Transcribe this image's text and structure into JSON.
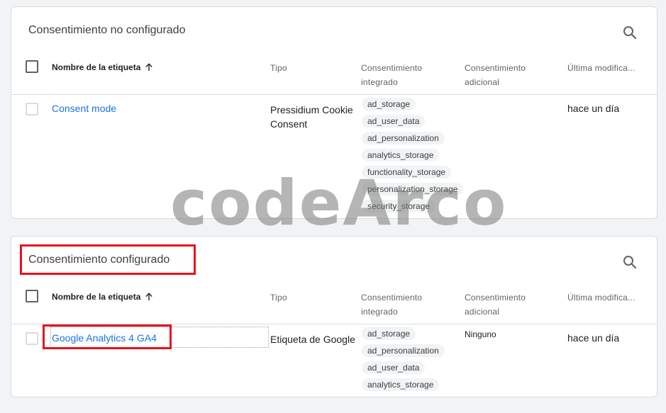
{
  "sections": [
    {
      "title": "Consentimiento no configurado",
      "columns": {
        "name": "Nombre de la etiqueta",
        "type": "Tipo",
        "integrated": "Consentimiento integrado",
        "additional": "Consentimiento adicional",
        "last_modified": "Última modifica..."
      },
      "rows": [
        {
          "name": "Consent mode",
          "type": "Pressidium Cookie Consent",
          "integrated": [
            "ad_storage",
            "ad_user_data",
            "ad_personalization",
            "analytics_storage",
            "functionality_storage",
            "personalization_storage",
            "security_storage"
          ],
          "additional": "",
          "last_modified": "hace un día"
        }
      ]
    },
    {
      "title": "Consentimiento configurado",
      "columns": {
        "name": "Nombre de la etiqueta",
        "type": "Tipo",
        "integrated": "Consentimiento integrado",
        "additional": "Consentimiento adicional",
        "last_modified": "Última modifica..."
      },
      "rows": [
        {
          "name": "Google Analytics 4 GA4",
          "type": "Etiqueta de Google",
          "integrated": [
            "ad_storage",
            "ad_personalization",
            "ad_user_data",
            "analytics_storage"
          ],
          "additional": "Ninguno",
          "last_modified": "hace un día"
        }
      ]
    }
  ],
  "icons": {
    "search": "search-icon",
    "sort": "arrow-up-icon"
  },
  "colors": {
    "link": "#1a73e8",
    "highlight": "#e8121b"
  },
  "watermark": "codeArco"
}
